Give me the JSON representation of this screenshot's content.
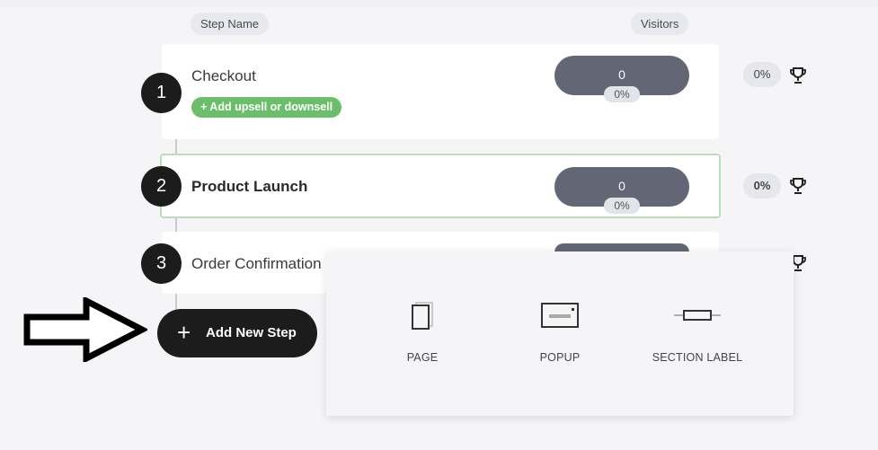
{
  "headers": {
    "step_name": "Step Name",
    "visitors": "Visitors"
  },
  "steps": [
    {
      "number": "1",
      "name": "Checkout",
      "visitors": "0",
      "visitor_pct": "0%",
      "conversion": "0%",
      "upsell_label": "+ Add upsell or downsell"
    },
    {
      "number": "2",
      "name": "Product Launch",
      "visitors": "0",
      "visitor_pct": "0%",
      "conversion": "0%"
    },
    {
      "number": "3",
      "name": "Order Confirmation"
    }
  ],
  "add_step": {
    "plus": "+",
    "label": "Add New Step"
  },
  "popover": {
    "items": [
      {
        "label": "PAGE",
        "icon": "page-icon"
      },
      {
        "label": "POPUP",
        "icon": "popup-icon"
      },
      {
        "label": "SECTION LABEL",
        "icon": "section-label-icon"
      }
    ]
  },
  "colors": {
    "accent_green": "#6cbf6a",
    "pill": "#636675",
    "dark": "#1c1c1c"
  }
}
